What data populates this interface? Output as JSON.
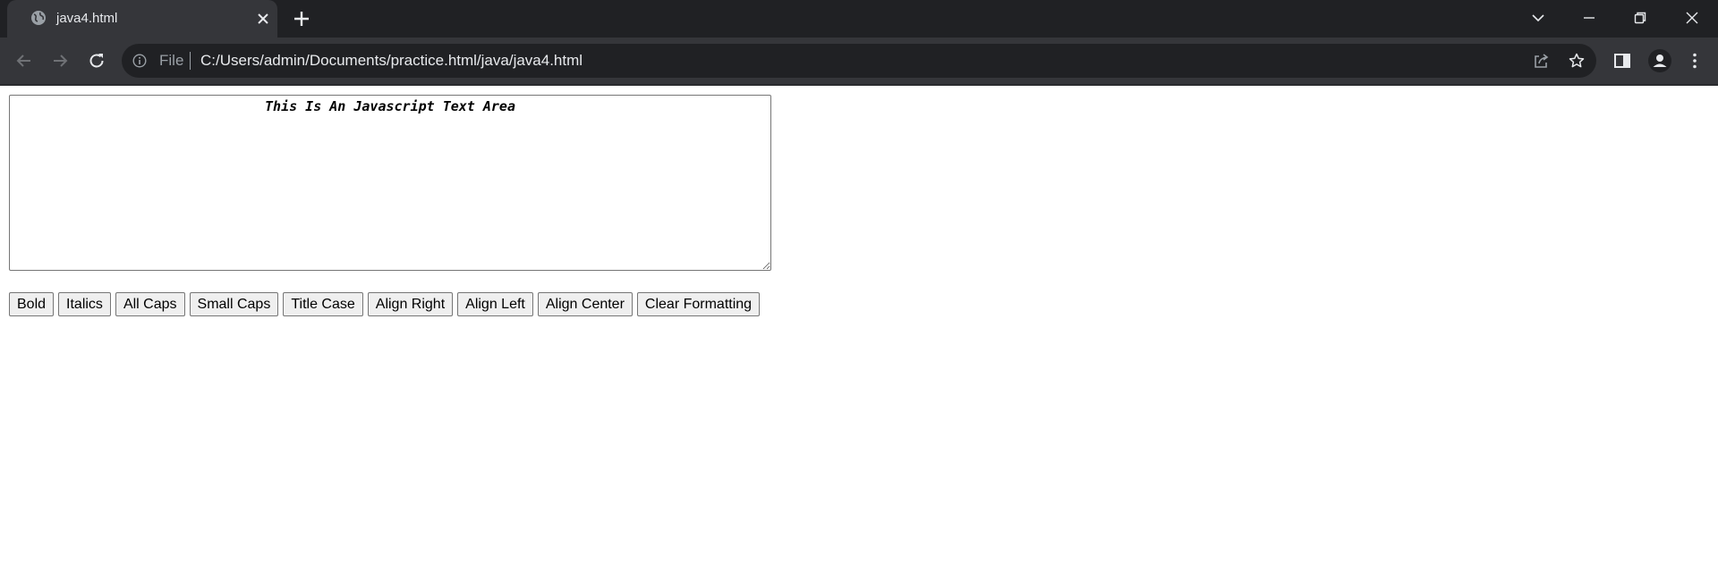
{
  "browser": {
    "tab": {
      "title": "java4.html",
      "favicon": "globe-icon"
    },
    "window_controls": [
      "tab-search-icon",
      "minimize-icon",
      "restore-icon",
      "close-icon"
    ],
    "toolbar": {
      "nav_icons": [
        "back-arrow-icon",
        "forward-arrow-icon",
        "reload-icon"
      ],
      "omnibox": {
        "scheme_label": "File",
        "url": "C:/Users/admin/Documents/practice.html/java/java4.html"
      },
      "right_icons": [
        "share-icon",
        "star-icon",
        "side-panel-icon",
        "profile-icon",
        "menu-dots-icon"
      ]
    },
    "colors": {
      "tabstrip_bg": "#202124",
      "active_tab_bg": "#35363a",
      "omnibox_bg": "#202124",
      "text_light": "#e8eaed",
      "text_muted": "#9aa0a6"
    }
  },
  "page": {
    "textarea": {
      "value": "This Is An Javascript Text Area"
    },
    "buttons": [
      {
        "label": "Bold"
      },
      {
        "label": "Italics"
      },
      {
        "label": "All Caps"
      },
      {
        "label": "Small Caps"
      },
      {
        "label": "Title Case"
      },
      {
        "label": "Align Right"
      },
      {
        "label": "Align Left"
      },
      {
        "label": "Align Center"
      },
      {
        "label": "Clear Formatting"
      }
    ]
  }
}
